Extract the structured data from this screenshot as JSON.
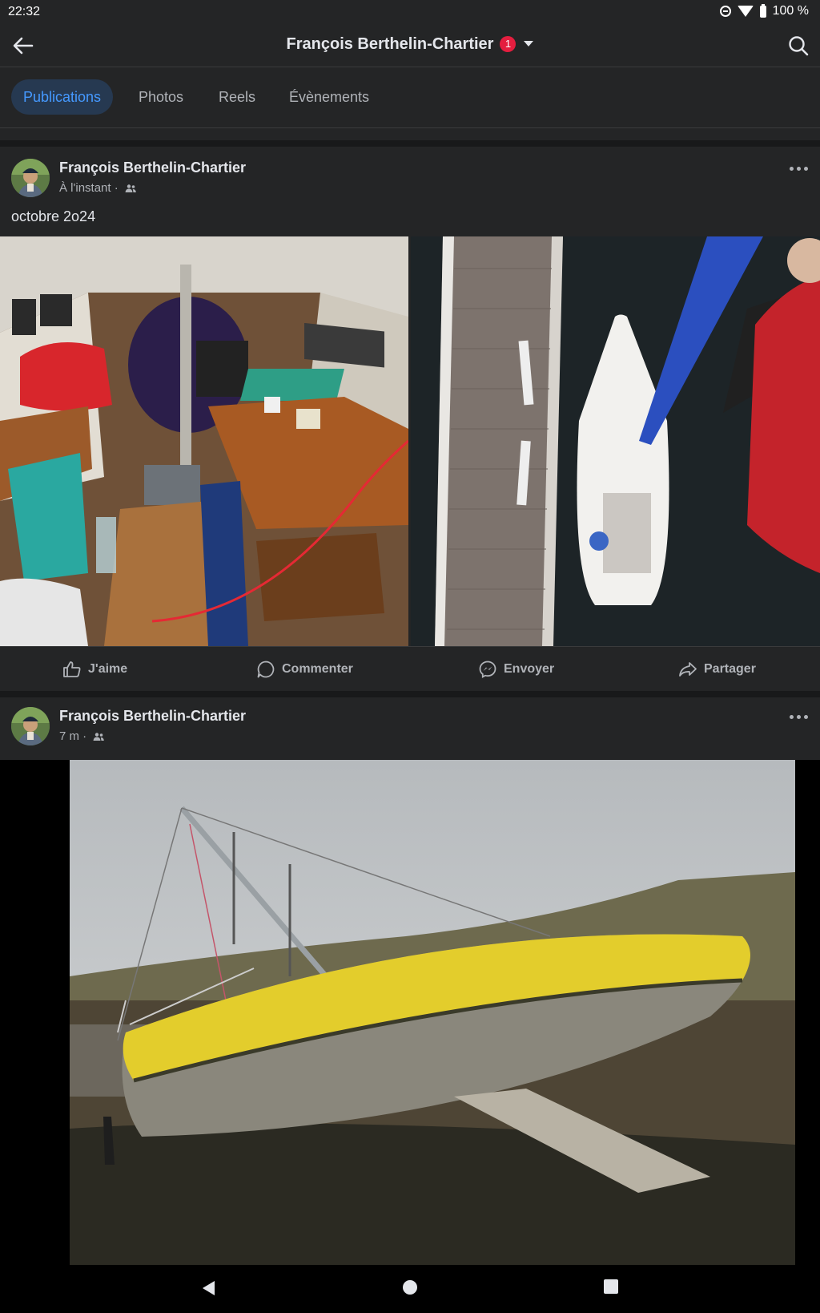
{
  "status_bar": {
    "time": "22:32",
    "battery": "100 %"
  },
  "top_bar": {
    "title": "François Berthelin-Chartier",
    "notification_count": "1"
  },
  "tabs": [
    {
      "label": "Publications",
      "active": true
    },
    {
      "label": "Photos",
      "active": false
    },
    {
      "label": "Reels",
      "active": false
    },
    {
      "label": "Évènements",
      "active": false
    }
  ],
  "posts": [
    {
      "author": "François Berthelin-Chartier",
      "time": "À l'instant ·",
      "audience_icon": "friends-icon",
      "text": "octobre 2o24",
      "photos": [
        "boat-cabin-interior-photo",
        "boat-at-pontoon-aerial-photo"
      ]
    },
    {
      "author": "François Berthelin-Chartier",
      "time": "7 m ·",
      "audience_icon": "friends-icon",
      "photos": [
        "yellow-sailboat-aground-photo"
      ]
    }
  ],
  "actions": {
    "like": "J'aime",
    "comment": "Commenter",
    "send": "Envoyer",
    "share": "Partager"
  },
  "colors": {
    "background": "#242526",
    "accent": "#4599ff",
    "tab_active_bg": "#263951",
    "badge": "#e41e3f"
  }
}
